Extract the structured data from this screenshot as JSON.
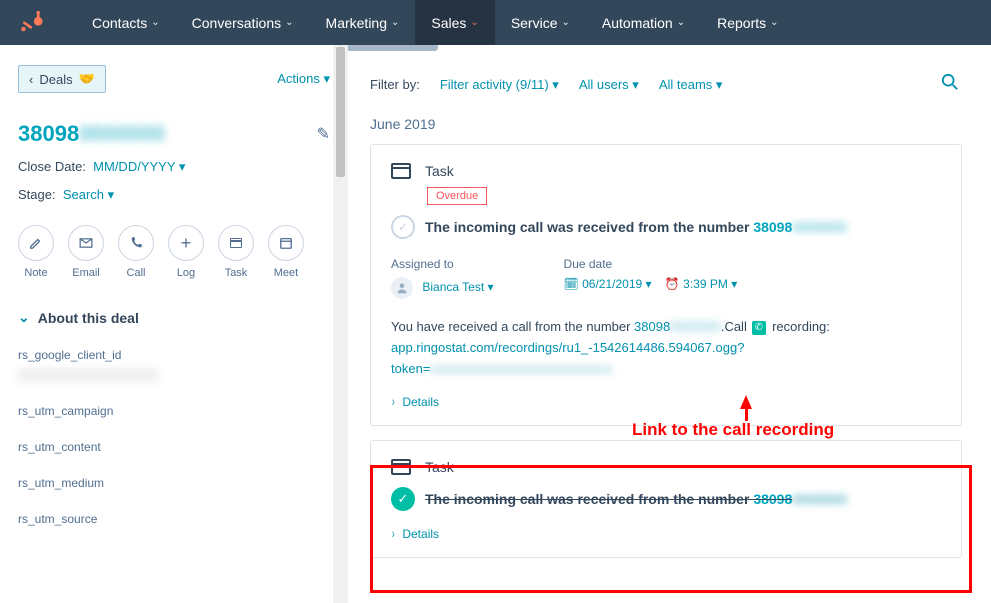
{
  "nav": {
    "items": [
      {
        "label": "Contacts"
      },
      {
        "label": "Conversations"
      },
      {
        "label": "Marketing"
      },
      {
        "label": "Sales"
      },
      {
        "label": "Service"
      },
      {
        "label": "Automation"
      },
      {
        "label": "Reports"
      }
    ]
  },
  "left": {
    "deals": "Deals",
    "actions": "Actions",
    "phone_prefix": "38098",
    "close_date_label": "Close Date:",
    "close_date_value": "MM/DD/YYYY",
    "stage_label": "Stage:",
    "stage_value": "Search",
    "actions_row": [
      {
        "label": "Note"
      },
      {
        "label": "Email"
      },
      {
        "label": "Call"
      },
      {
        "label": "Log"
      },
      {
        "label": "Task"
      },
      {
        "label": "Meet"
      }
    ],
    "about_header": "About this deal",
    "fields": [
      {
        "label": "rs_google_client_id"
      },
      {
        "label": "rs_utm_campaign"
      },
      {
        "label": "rs_utm_content"
      },
      {
        "label": "rs_utm_medium"
      },
      {
        "label": "rs_utm_source"
      }
    ]
  },
  "filter": {
    "label": "Filter by:",
    "activity": "Filter activity (9/11)",
    "users": "All users",
    "teams": "All teams"
  },
  "month": "June 2019",
  "task1": {
    "label": "Task",
    "overdue": "Overdue",
    "title_pre": "The incoming call was received from the number ",
    "title_num": "38098",
    "assigned_label": "Assigned to",
    "assigned_value": "Bianca Test",
    "due_label": "Due date",
    "due_date": "06/21/2019",
    "due_time": "3:39 PM",
    "body_pre": "You have received a call from the number ",
    "body_num": "38098",
    "body_call": ".Call",
    "body_rec": " recording: ",
    "body_url": "app.ringostat.com/recordings/ru1_-1542614486.594067.ogg?",
    "body_token": "token=",
    "details": "Details"
  },
  "task2": {
    "label": "Task",
    "title_pre": "The incoming call was received from the number ",
    "title_num": "38098",
    "details": "Details"
  },
  "annotation": "Link to the call recording"
}
